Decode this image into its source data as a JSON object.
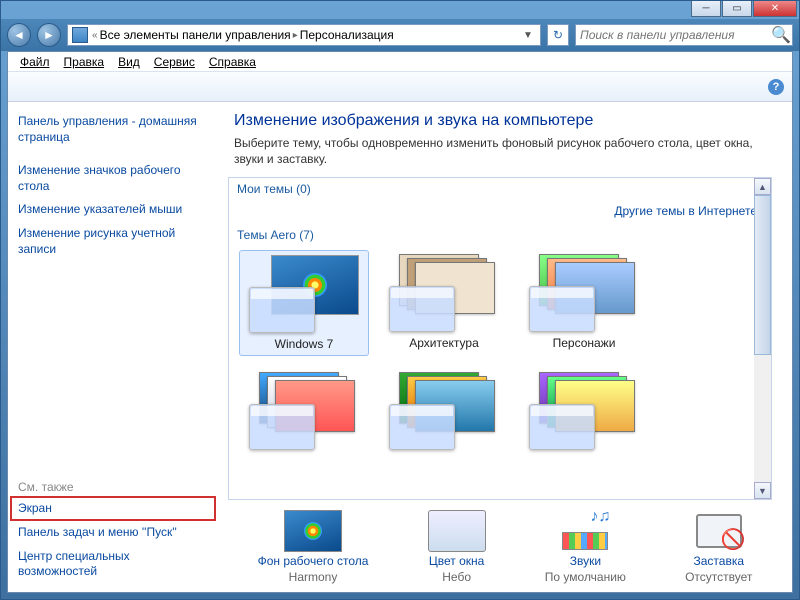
{
  "breadcrumb": {
    "sep": "«",
    "p1": "Все элементы панели управления",
    "arrow": "▸",
    "p2": "Персонализация"
  },
  "search": {
    "placeholder": "Поиск в панели управления"
  },
  "menu": {
    "file": "Файл",
    "edit": "Правка",
    "view": "Вид",
    "tools": "Сервис",
    "help": "Справка"
  },
  "sidebar": {
    "home": "Панель управления - домашняя страница",
    "links": [
      "Изменение значков рабочего стола",
      "Изменение указателей мыши",
      "Изменение рисунка учетной записи"
    ],
    "see_also": "См. также",
    "footer": [
      "Экран",
      "Панель задач и меню ''Пуск''",
      "Центр специальных возможностей"
    ]
  },
  "page": {
    "title": "Изменение изображения и звука на компьютере",
    "subtitle": "Выберите тему, чтобы одновременно изменить фоновый рисунок рабочего стола, цвет окна, звуки и заставку."
  },
  "themes": {
    "my": "Мои темы (0)",
    "online": "Другие темы в Интернете",
    "aero": "Темы Aero (7)",
    "items": [
      "Windows 7",
      "Архитектура",
      "Персонажи"
    ]
  },
  "bottom": [
    {
      "label": "Фон рабочего стола",
      "value": "Harmony"
    },
    {
      "label": "Цвет окна",
      "value": "Небо"
    },
    {
      "label": "Звуки",
      "value": "По умолчанию"
    },
    {
      "label": "Заставка",
      "value": "Отсутствует"
    }
  ]
}
